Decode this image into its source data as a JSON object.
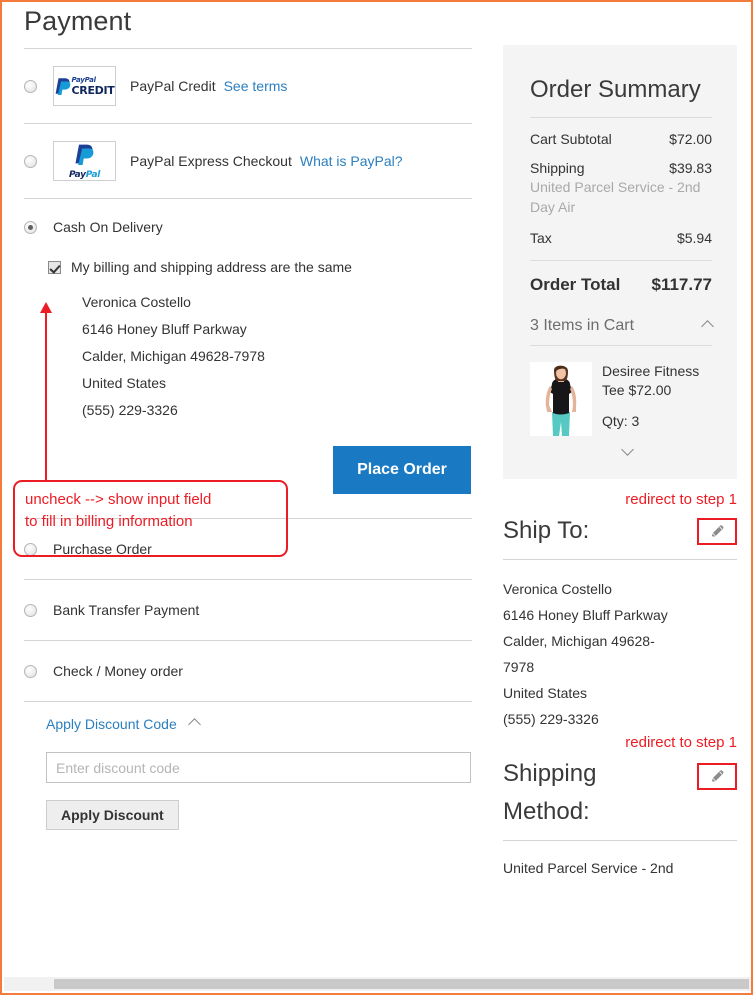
{
  "page": {
    "title": "Payment"
  },
  "payment_methods": [
    {
      "id": "paypal-credit",
      "label": "PayPal Credit",
      "link": "See terms",
      "logo": "paypal-credit-logo",
      "logo_text_top": "PayPal",
      "logo_text_bottom": "CREDIT",
      "selected": false
    },
    {
      "id": "paypal-express",
      "label": "PayPal Express Checkout",
      "link": "What is PayPal?",
      "logo": "paypal-logo",
      "logo_wordmark_a": "Pay",
      "logo_wordmark_b": "Pal",
      "selected": false
    },
    {
      "id": "cash-on-delivery",
      "label": "Cash On Delivery",
      "selected": true
    },
    {
      "id": "purchase-order",
      "label": "Purchase Order",
      "selected": false
    },
    {
      "id": "bank-transfer",
      "label": "Bank Transfer Payment",
      "selected": false
    },
    {
      "id": "check-money-order",
      "label": "Check / Money order",
      "selected": false
    }
  ],
  "cod": {
    "same_address_label": "My billing and shipping address are the same",
    "same_address_checked": true,
    "billing_address": [
      "Veronica Costello",
      "6146 Honey Bluff Parkway",
      "Calder, Michigan 49628-7978",
      "United States",
      "(555) 229-3326"
    ],
    "place_order_label": "Place Order"
  },
  "annotations": {
    "uncheck_note_line1": "uncheck --> show input field",
    "uncheck_note_line2": "to fill in billing information",
    "redirect_ship_to": "redirect to step 1",
    "redirect_shipping_method": "redirect to step 1",
    "color": "#ec1c24"
  },
  "discount": {
    "toggle_label": "Apply Discount Code",
    "expanded": true,
    "input_value": "",
    "input_placeholder": "Enter discount code",
    "apply_label": "Apply Discount"
  },
  "order_summary": {
    "title": "Order Summary",
    "rows": [
      {
        "label": "Cart Subtotal",
        "value": "$72.00",
        "sublabel": ""
      },
      {
        "label": "Shipping",
        "value": "$39.83",
        "sublabel": "United Parcel Service - 2nd Day Air"
      },
      {
        "label": "Tax",
        "value": "$5.94",
        "sublabel": ""
      }
    ],
    "total_label": "Order Total",
    "total_value": "$117.77",
    "items_toggle_label": "3 Items in Cart",
    "items_expanded": true,
    "items": [
      {
        "name": "Desiree Fitness Tee",
        "price": "$72.00",
        "qty_label": "Qty: 3",
        "thumb": "product-thumbnail-desiree-fitness-tee"
      }
    ]
  },
  "ship_to": {
    "title": "Ship To:",
    "edit_icon": "pencil-icon",
    "lines": [
      "Veronica Costello",
      "6146 Honey Bluff Parkway",
      "Calder, Michigan 49628-",
      "7978",
      "United States",
      "(555) 229-3326"
    ]
  },
  "shipping_method": {
    "title_line1": "Shipping",
    "title_line2": "Method:",
    "edit_icon": "pencil-icon",
    "value": "United Parcel Service - 2nd"
  },
  "colors": {
    "frame_border": "#f37b3c",
    "primary_button": "#1979c3",
    "link": "#2b7fc0",
    "annotation": "#ec1c24",
    "summary_bg": "#f4f4f4"
  }
}
